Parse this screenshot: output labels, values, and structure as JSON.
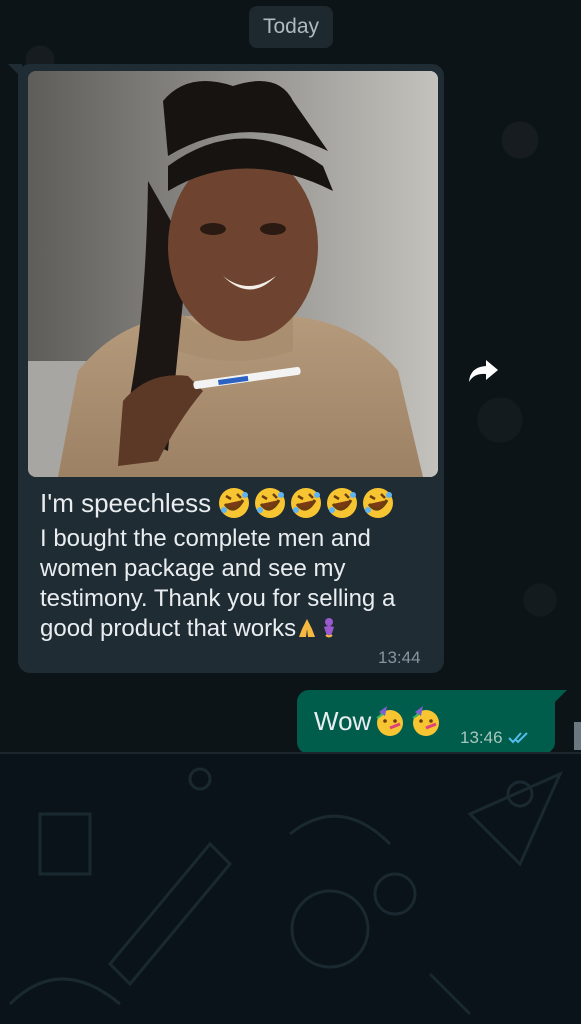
{
  "date_separator": "Today",
  "incoming": {
    "caption_line1": "I'm speechless",
    "caption_body": "I bought the complete men and women package and see my testimony. Thank you for selling a good product that works",
    "time": "13:44",
    "line1_emojis": [
      "rolling-on-floor-laughing",
      "rolling-on-floor-laughing",
      "rolling-on-floor-laughing",
      "rolling-on-floor-laughing",
      "rolling-on-floor-laughing"
    ],
    "end_emojis": [
      "folded-hands",
      "genie"
    ]
  },
  "outgoing": {
    "text": "Wow",
    "emojis": [
      "partying-face",
      "partying-face"
    ],
    "time": "13:46",
    "status": "read"
  },
  "colors": {
    "incoming_bubble": "#1f2c34",
    "outgoing_bubble": "#005c4b",
    "read_ticks": "#53bdeb",
    "background": "#0b141a"
  },
  "icons": {
    "forward": "forward-arrow-icon"
  }
}
